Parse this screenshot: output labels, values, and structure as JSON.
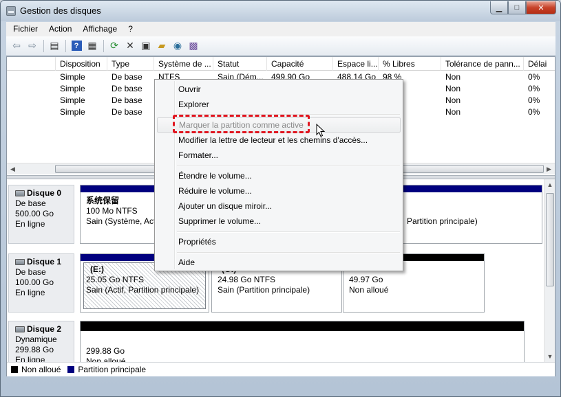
{
  "window": {
    "title": "Gestion des disques"
  },
  "menu": [
    "Fichier",
    "Action",
    "Affichage",
    "?"
  ],
  "toolbar": {
    "icons": [
      "arrow-left-icon",
      "arrow-right-icon",
      "console-tree-icon",
      "help-icon",
      "properties-grid-icon",
      "refresh-icon",
      "delete-x-icon",
      "properties-icon",
      "open-folder-icon",
      "search-volume-icon",
      "wizard-icon"
    ]
  },
  "columns": [
    "Disposition",
    "Type",
    "Système de ...",
    "Statut",
    "Capacité",
    "Espace li...",
    "% Libres",
    "Tolérance de pann...",
    "Délai"
  ],
  "rows": [
    [
      "Simple",
      "De base",
      "NTFS",
      "Sain (Dém...",
      "499.90 Go",
      "488.14 Go",
      "98 %",
      "Non",
      "0%"
    ],
    [
      "Simple",
      "De base",
      "",
      "",
      "",
      "",
      "",
      "Non",
      "0%"
    ],
    [
      "Simple",
      "De base",
      "",
      "",
      "",
      "",
      "",
      "Non",
      "0%"
    ],
    [
      "Simple",
      "De base",
      "",
      "",
      "",
      "",
      "",
      "Non",
      "0%"
    ]
  ],
  "disks": [
    {
      "name": "Disque 0",
      "type": "De base",
      "size": "500.00 Go",
      "state": "En ligne"
    },
    {
      "name": "Disque 1",
      "type": "De base",
      "size": "100.00 Go",
      "state": "En ligne"
    },
    {
      "name": "Disque 2",
      "type": "Dynamique",
      "size": "299.88 Go",
      "state": "En ligne"
    }
  ],
  "volumes": {
    "d0_sys": {
      "title": "系统保留",
      "size": "100 Mo NTFS",
      "status": "Sain (Système, Actif"
    },
    "d0_main": {
      "status": "Partition principale)"
    },
    "d1_e": {
      "title": "(E:)",
      "size": "25.05 Go NTFS",
      "status": "Sain (Actif, Partition principale)"
    },
    "d1_g": {
      "title": "(G:)",
      "size": "24.98 Go NTFS",
      "status": "Sain (Partition principale)"
    },
    "d1_free": {
      "size": "49.97 Go",
      "status": "Non alloué"
    },
    "d2_free": {
      "size": "299.88 Go",
      "status": "Non alloué"
    }
  },
  "legend": [
    {
      "label": "Non alloué",
      "color": "#000000"
    },
    {
      "label": "Partition principale",
      "color": "#00007f"
    }
  ],
  "context_menu": {
    "items": [
      {
        "label": "Ouvrir",
        "disabled": false
      },
      {
        "label": "Explorer",
        "disabled": false
      },
      {
        "label": "Marquer la partition comme active",
        "disabled": true
      },
      {
        "label": "Modifier la lettre de lecteur et les chemins d'accès...",
        "disabled": false
      },
      {
        "label": "Formater...",
        "disabled": false
      },
      {
        "label": "Étendre le volume...",
        "disabled": false
      },
      {
        "label": "Réduire le volume...",
        "disabled": false
      },
      {
        "label": "Ajouter un disque miroir...",
        "disabled": false
      },
      {
        "label": "Supprimer le volume...",
        "disabled": false
      },
      {
        "label": "Propriétés",
        "disabled": false
      },
      {
        "label": "Aide",
        "disabled": false
      }
    ]
  },
  "colors": {
    "primary_partition": "#00007f",
    "unallocated": "#000000",
    "highlight": "#e0141e"
  }
}
